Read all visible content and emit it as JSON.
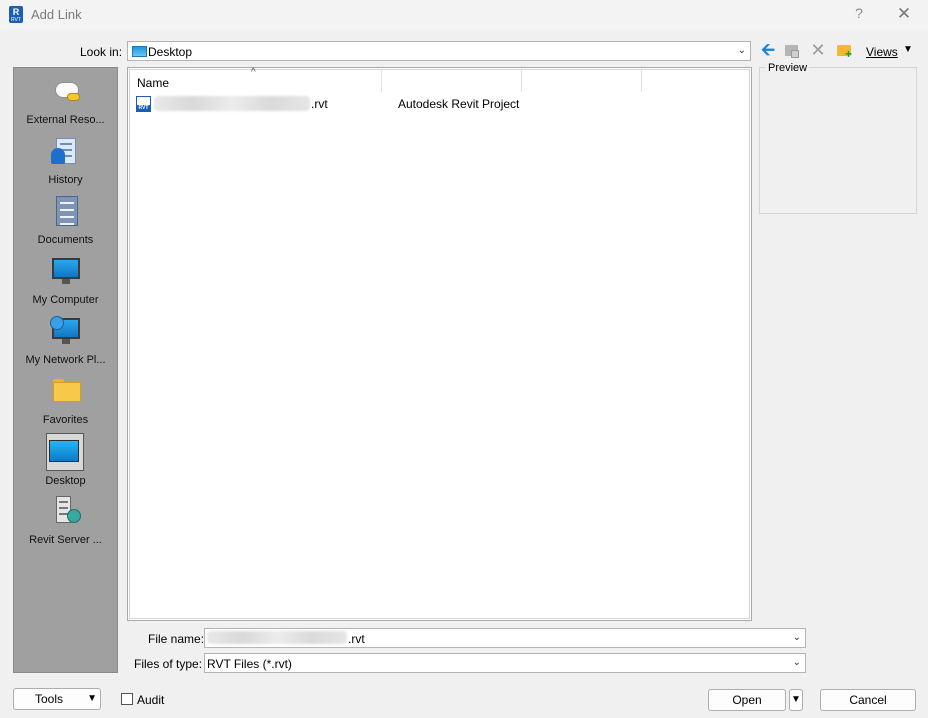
{
  "window": {
    "title": "Add Link",
    "help_label": "?",
    "close_label": "✕",
    "app_icon_letter": "R",
    "app_icon_sub": "RVT"
  },
  "lookin": {
    "label": "Look in:",
    "value": "Desktop"
  },
  "toolbar": {
    "back_icon": "arrow-left-icon",
    "up_icon": "up-one-level-icon",
    "delete_icon": "delete-icon",
    "new_folder_icon": "new-folder-icon",
    "views_label": "Views"
  },
  "places": [
    {
      "label": "External Reso...",
      "icon": "cloud-icon"
    },
    {
      "label": "History",
      "icon": "history-icon"
    },
    {
      "label": "Documents",
      "icon": "documents-icon"
    },
    {
      "label": "My Computer",
      "icon": "computer-icon"
    },
    {
      "label": "My Network Pl...",
      "icon": "network-icon"
    },
    {
      "label": "Favorites",
      "icon": "folder-icon"
    },
    {
      "label": "Desktop",
      "icon": "desktop-icon",
      "selected": true
    },
    {
      "label": "Revit Server ...",
      "icon": "server-icon"
    }
  ],
  "filelist": {
    "columns": [
      "Name",
      "",
      "",
      ""
    ],
    "rows": [
      {
        "name_ext": ".rvt",
        "type": "Autodesk Revit Project",
        "icon": "rvt-file-icon",
        "icon_label": "RVT"
      }
    ]
  },
  "preview": {
    "label": "Preview"
  },
  "file_name": {
    "label": "File name:",
    "value_ext": ".rvt"
  },
  "file_type": {
    "label": "Files of type:",
    "value": "RVT Files  (*.rvt)"
  },
  "buttons": {
    "tools": "Tools",
    "audit": "Audit",
    "open": "Open",
    "cancel": "Cancel"
  }
}
